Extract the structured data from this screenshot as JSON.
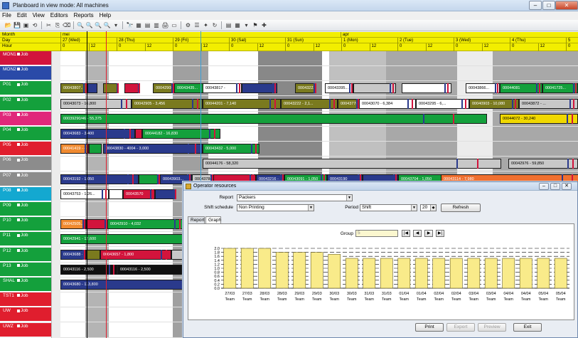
{
  "window": {
    "title": "Planboard in view mode: All machines"
  },
  "menu": [
    "File",
    "Edit",
    "View",
    "Editors",
    "Reports",
    "Help"
  ],
  "headers": {
    "month_label": "Month",
    "day_label": "Day",
    "hour_label": "Hour",
    "months": [
      {
        "label": "mei",
        "start": 0
      },
      {
        "label": "apr",
        "start": 5
      }
    ],
    "days": [
      "27 (Wed)",
      "28 (Thu)",
      "29 (Fri)",
      "30 (Sat)",
      "31 (Sun)",
      "1 (Mon)",
      "2 (Tue)",
      "3 (Wed)",
      "4 (Thu)",
      "5"
    ],
    "hour_marks": [
      "0",
      "12"
    ]
  },
  "machines": [
    {
      "code": "MON1",
      "job": "Job",
      "color": "#d2143c"
    },
    {
      "code": "MON2",
      "job": "Job",
      "color": "#2a4aa8"
    },
    {
      "code": "P01",
      "job": "Job",
      "color": "#14a03c"
    },
    {
      "code": "P02",
      "job": "Job",
      "color": "#14a03c"
    },
    {
      "code": "P03",
      "job": "Job",
      "color": "#e0287a"
    },
    {
      "code": "P04",
      "job": "Job",
      "color": "#14a03c"
    },
    {
      "code": "P05",
      "job": "Job",
      "color": "#e01e2e"
    },
    {
      "code": "P06",
      "job": "Job",
      "color": "#8c8c8c"
    },
    {
      "code": "P07",
      "job": "Job",
      "color": "#8c8c8c"
    },
    {
      "code": "P08",
      "job": "Job",
      "color": "#14a8d0"
    },
    {
      "code": "P09",
      "job": "Job",
      "color": "#14a03c"
    },
    {
      "code": "P10",
      "job": "Job",
      "color": "#14a03c"
    },
    {
      "code": "P11",
      "job": "Job",
      "color": "#14a03c"
    },
    {
      "code": "P12",
      "job": "Job",
      "color": "#14a03c"
    },
    {
      "code": "P13",
      "job": "Job",
      "color": "#14a03c"
    },
    {
      "code": "SHAL",
      "job": "Job",
      "color": "#14a03c"
    },
    {
      "code": "TST1",
      "job": "Job",
      "color": "#e01e2e"
    },
    {
      "code": "UW",
      "job": "Job",
      "color": "#e01e2e"
    },
    {
      "code": "UWZ",
      "job": "Job",
      "color": "#e01e2e"
    }
  ],
  "jobs": [
    {
      "label": "00043807...",
      "color": "#7a7a1e"
    },
    {
      "label": "00043073 - 16,800",
      "color": "#c8c8c8"
    },
    {
      "label": "00042905 - 3,456",
      "color": "#7a7a1e"
    },
    {
      "label": "00044201 - 7,140",
      "color": "#7a7a1e"
    },
    {
      "label": "00043222 - 2,1...",
      "color": "#7a7a1e"
    },
    {
      "label": "00043778 - 2,...",
      "color": "#7a7a1e"
    },
    {
      "label": "00043070 - 6,384",
      "color": "#ffffff"
    },
    {
      "label": "00043295 - 6,...",
      "color": "#ffffff"
    },
    {
      "label": "00040903 - 10,080",
      "color": "#7a7a1e"
    },
    {
      "label": "00043872 - ...",
      "color": "#c8c8c8"
    },
    {
      "label": "00039290/46 - 55,375",
      "color": "#14a03c"
    },
    {
      "label": "00044072 - 30,240",
      "color": "#f0d800"
    },
    {
      "label": "00043683 - 3,400",
      "color": "#2a3a8c"
    },
    {
      "label": "00044182 - 16,830",
      "color": "#14a03c"
    },
    {
      "label": "00041419 - 4...",
      "color": "#f08a30"
    },
    {
      "label": "00043830 - 4004 - 3,000",
      "color": "#2a3a8c"
    },
    {
      "label": "00043432 - 5,000",
      "color": "#14a03c"
    },
    {
      "label": "00044176 - 58,320",
      "color": "#c8c8c8"
    },
    {
      "label": "00042976 - 59,850",
      "color": "#c8c8c8"
    },
    {
      "label": "00043192 - 1,050",
      "color": "#2a3a8c"
    },
    {
      "label": "00043216 - ...",
      "color": "#2a3a8c"
    },
    {
      "label": "00043091 - 1,050",
      "color": "#14a03c"
    },
    {
      "label": "00043190",
      "color": "#2a3a8c"
    },
    {
      "label": "00043704 - 1,050",
      "color": "#14a03c"
    },
    {
      "label": "00043114 - 7,980",
      "color": "#f07030"
    },
    {
      "label": "00043753 - 1,26...",
      "color": "#ffffff"
    },
    {
      "label": "00042910 - 4,032",
      "color": "#14a03c"
    },
    {
      "label": "00042505...",
      "color": "#f08a30"
    },
    {
      "label": "00042941 - 12,600",
      "color": "#14a03c"
    },
    {
      "label": "00043688 - 1,008",
      "color": "#2a3a8c"
    },
    {
      "label": "00043657 - 1,800",
      "color": "#d2143c"
    },
    {
      "label": "00043116 - 2,500",
      "color": "#101010"
    },
    {
      "label": "00043680 - 113,800",
      "color": "#2a3a8c"
    },
    {
      "label": "00044081",
      "color": "#14a03c"
    },
    {
      "label": "00043435...",
      "color": "#14a03c"
    },
    {
      "label": "00043817 -",
      "color": "#ffffff"
    },
    {
      "label": "00043784 -",
      "color": "#c8c8c8"
    },
    {
      "label": "00043903...",
      "color": "#2a3a8c"
    },
    {
      "label": "00043395...",
      "color": "#ffffff"
    },
    {
      "label": "00043866...",
      "color": "#ffffff"
    },
    {
      "label": "00041725...",
      "color": "#14a03c"
    },
    {
      "label": "00043570",
      "color": "#d2143c"
    }
  ],
  "dialog": {
    "title": "Operator resources",
    "report_label": "Report",
    "report_value": "Packers",
    "shift_label": "Shift schedule",
    "shift_value": "Non Printing",
    "period_label": "Period",
    "period_value": "Shift",
    "period_count": "20",
    "refresh": "Refresh",
    "tabs": [
      "Report",
      "Graph"
    ],
    "group_label": "Group",
    "group_value": "5",
    "nav": [
      "|◀",
      "◀",
      "▶",
      "▶|"
    ],
    "buttons": {
      "print": "Print",
      "export": "Export",
      "preview": "Preview",
      "exit": "Exit"
    }
  },
  "chart_data": {
    "type": "bar",
    "y_ticks": [
      "2.0",
      "1.8",
      "1.6",
      "1.4",
      "1.2",
      "1.0",
      "0.8",
      "0.6",
      "0.4",
      "0.2",
      "0.0"
    ],
    "ylim": [
      0,
      2.0
    ],
    "categories": [
      "27/03",
      "27/03",
      "28/03",
      "28/03",
      "29/03",
      "29/03",
      "30/03",
      "30/03",
      "31/03",
      "31/03",
      "01/04",
      "01/04",
      "02/04",
      "02/04",
      "03/04",
      "03/04",
      "04/04",
      "04/04",
      "05/04",
      "05/04"
    ],
    "category_sub": "Team",
    "values": [
      2.0,
      2.0,
      2.0,
      1.8,
      1.8,
      1.8,
      1.7,
      1.5,
      1.5,
      1.5,
      1.5,
      1.5,
      1.5,
      1.5,
      1.5,
      1.5,
      1.5,
      1.5,
      1.5,
      1.5
    ]
  }
}
